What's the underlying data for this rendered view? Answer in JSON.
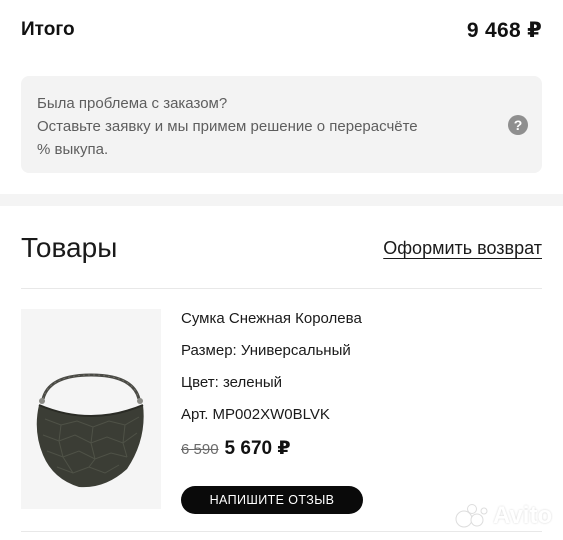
{
  "summary": {
    "total_label": "Итого",
    "total_value": "9 468 ₽"
  },
  "notice": {
    "lines": [
      "Была проблема с заказом?",
      "Оставьте заявку и мы примем решение о перерасчёте",
      "% выкупа."
    ],
    "help_icon": "question-circle-icon",
    "help_glyph": "?"
  },
  "products_section": {
    "title": "Товары",
    "return_link": "Оформить возврат"
  },
  "product": {
    "name": "Сумка Снежная Королева",
    "size": "Размер: Универсальный",
    "color": "Цвет: зеленый",
    "sku": "Арт. MP002XW0BLVK",
    "old_price": "6 590",
    "new_price": "5 670 ₽",
    "review_button": "НАПИШИТЕ ОТЗЫВ",
    "image_icon": "handbag-image"
  },
  "watermark": {
    "text": "Avito",
    "icon": "avito-logo-icon"
  },
  "colors": {
    "notice_bg": "#f3f3f3",
    "button_bg": "#0a0a0a",
    "text_primary": "#111111",
    "text_secondary": "#5e5e5e"
  }
}
